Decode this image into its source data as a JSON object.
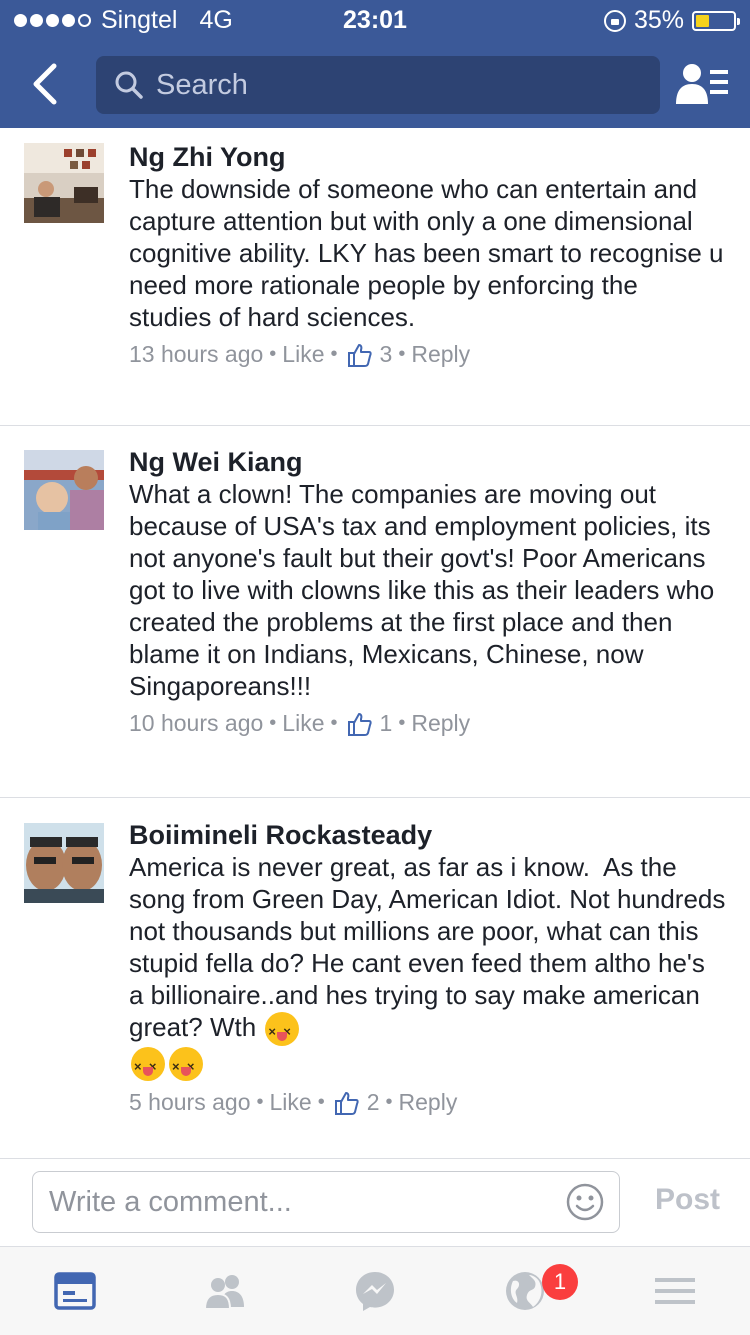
{
  "status_bar": {
    "carrier": "Singtel",
    "network": "4G",
    "time": "23:01",
    "battery": "35%"
  },
  "search": {
    "placeholder": "Search"
  },
  "comments": [
    {
      "author": "Ng Zhi Yong",
      "text": "The downside of someone who can entertain and capture attention but with only a one dimensional cognitive ability. LKY has been smart to recognise u need more rationale people by enforcing the studies of hard sciences.",
      "time": "13 hours ago",
      "like_label": "Like",
      "likes": "3",
      "reply_label": "Reply"
    },
    {
      "author": "Ng Wei Kiang",
      "text": "What a clown! The companies are moving out because of USA's tax and employment policies, its not anyone's fault but their govt's! Poor Americans got to live with clowns like this as their leaders who created the problems at the first place and then blame it on Indians, Mexicans, Chinese, now Singaporeans!!!",
      "time": "10 hours ago",
      "like_label": "Like",
      "likes": "1",
      "reply_label": "Reply"
    },
    {
      "author": "Boiimineli Rockasteady",
      "text": "America is never great, as far as i know.  As the song from Green Day, American Idiot. Not hundreds not thousands but millions are poor, what can this stupid fella do? He cant even feed them altho he's a billionaire..and hes trying to say make american great? Wth",
      "time": "5 hours ago",
      "like_label": "Like",
      "likes": "2",
      "reply_label": "Reply"
    }
  ],
  "composer": {
    "placeholder": "Write a comment...",
    "post_label": "Post"
  },
  "tabbar": {
    "notifications_badge": "1"
  },
  "colors": {
    "brand": "#3b5998",
    "active_tab": "#4267b2",
    "badge": "#fa3e3e"
  },
  "icons": [
    "back-arrow-icon",
    "search-icon",
    "friends-list-icon",
    "like-thumb-icon",
    "smiley-icon",
    "news-feed-icon",
    "friends-icon",
    "messenger-icon",
    "globe-icon",
    "menu-icon"
  ]
}
